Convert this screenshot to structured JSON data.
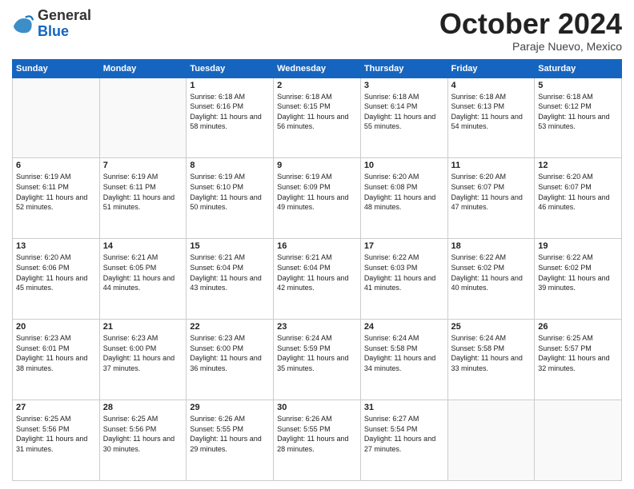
{
  "logo": {
    "general": "General",
    "blue": "Blue",
    "icon_color": "#1a7abf"
  },
  "header": {
    "month": "October 2024",
    "location": "Paraje Nuevo, Mexico"
  },
  "weekdays": [
    "Sunday",
    "Monday",
    "Tuesday",
    "Wednesday",
    "Thursday",
    "Friday",
    "Saturday"
  ],
  "weeks": [
    [
      {
        "day": "",
        "empty": true
      },
      {
        "day": "",
        "empty": true
      },
      {
        "day": "1",
        "sunrise": "Sunrise: 6:18 AM",
        "sunset": "Sunset: 6:16 PM",
        "daylight": "Daylight: 11 hours and 58 minutes."
      },
      {
        "day": "2",
        "sunrise": "Sunrise: 6:18 AM",
        "sunset": "Sunset: 6:15 PM",
        "daylight": "Daylight: 11 hours and 56 minutes."
      },
      {
        "day": "3",
        "sunrise": "Sunrise: 6:18 AM",
        "sunset": "Sunset: 6:14 PM",
        "daylight": "Daylight: 11 hours and 55 minutes."
      },
      {
        "day": "4",
        "sunrise": "Sunrise: 6:18 AM",
        "sunset": "Sunset: 6:13 PM",
        "daylight": "Daylight: 11 hours and 54 minutes."
      },
      {
        "day": "5",
        "sunrise": "Sunrise: 6:18 AM",
        "sunset": "Sunset: 6:12 PM",
        "daylight": "Daylight: 11 hours and 53 minutes."
      }
    ],
    [
      {
        "day": "6",
        "sunrise": "Sunrise: 6:19 AM",
        "sunset": "Sunset: 6:11 PM",
        "daylight": "Daylight: 11 hours and 52 minutes."
      },
      {
        "day": "7",
        "sunrise": "Sunrise: 6:19 AM",
        "sunset": "Sunset: 6:11 PM",
        "daylight": "Daylight: 11 hours and 51 minutes."
      },
      {
        "day": "8",
        "sunrise": "Sunrise: 6:19 AM",
        "sunset": "Sunset: 6:10 PM",
        "daylight": "Daylight: 11 hours and 50 minutes."
      },
      {
        "day": "9",
        "sunrise": "Sunrise: 6:19 AM",
        "sunset": "Sunset: 6:09 PM",
        "daylight": "Daylight: 11 hours and 49 minutes."
      },
      {
        "day": "10",
        "sunrise": "Sunrise: 6:20 AM",
        "sunset": "Sunset: 6:08 PM",
        "daylight": "Daylight: 11 hours and 48 minutes."
      },
      {
        "day": "11",
        "sunrise": "Sunrise: 6:20 AM",
        "sunset": "Sunset: 6:07 PM",
        "daylight": "Daylight: 11 hours and 47 minutes."
      },
      {
        "day": "12",
        "sunrise": "Sunrise: 6:20 AM",
        "sunset": "Sunset: 6:07 PM",
        "daylight": "Daylight: 11 hours and 46 minutes."
      }
    ],
    [
      {
        "day": "13",
        "sunrise": "Sunrise: 6:20 AM",
        "sunset": "Sunset: 6:06 PM",
        "daylight": "Daylight: 11 hours and 45 minutes."
      },
      {
        "day": "14",
        "sunrise": "Sunrise: 6:21 AM",
        "sunset": "Sunset: 6:05 PM",
        "daylight": "Daylight: 11 hours and 44 minutes."
      },
      {
        "day": "15",
        "sunrise": "Sunrise: 6:21 AM",
        "sunset": "Sunset: 6:04 PM",
        "daylight": "Daylight: 11 hours and 43 minutes."
      },
      {
        "day": "16",
        "sunrise": "Sunrise: 6:21 AM",
        "sunset": "Sunset: 6:04 PM",
        "daylight": "Daylight: 11 hours and 42 minutes."
      },
      {
        "day": "17",
        "sunrise": "Sunrise: 6:22 AM",
        "sunset": "Sunset: 6:03 PM",
        "daylight": "Daylight: 11 hours and 41 minutes."
      },
      {
        "day": "18",
        "sunrise": "Sunrise: 6:22 AM",
        "sunset": "Sunset: 6:02 PM",
        "daylight": "Daylight: 11 hours and 40 minutes."
      },
      {
        "day": "19",
        "sunrise": "Sunrise: 6:22 AM",
        "sunset": "Sunset: 6:02 PM",
        "daylight": "Daylight: 11 hours and 39 minutes."
      }
    ],
    [
      {
        "day": "20",
        "sunrise": "Sunrise: 6:23 AM",
        "sunset": "Sunset: 6:01 PM",
        "daylight": "Daylight: 11 hours and 38 minutes."
      },
      {
        "day": "21",
        "sunrise": "Sunrise: 6:23 AM",
        "sunset": "Sunset: 6:00 PM",
        "daylight": "Daylight: 11 hours and 37 minutes."
      },
      {
        "day": "22",
        "sunrise": "Sunrise: 6:23 AM",
        "sunset": "Sunset: 6:00 PM",
        "daylight": "Daylight: 11 hours and 36 minutes."
      },
      {
        "day": "23",
        "sunrise": "Sunrise: 6:24 AM",
        "sunset": "Sunset: 5:59 PM",
        "daylight": "Daylight: 11 hours and 35 minutes."
      },
      {
        "day": "24",
        "sunrise": "Sunrise: 6:24 AM",
        "sunset": "Sunset: 5:58 PM",
        "daylight": "Daylight: 11 hours and 34 minutes."
      },
      {
        "day": "25",
        "sunrise": "Sunrise: 6:24 AM",
        "sunset": "Sunset: 5:58 PM",
        "daylight": "Daylight: 11 hours and 33 minutes."
      },
      {
        "day": "26",
        "sunrise": "Sunrise: 6:25 AM",
        "sunset": "Sunset: 5:57 PM",
        "daylight": "Daylight: 11 hours and 32 minutes."
      }
    ],
    [
      {
        "day": "27",
        "sunrise": "Sunrise: 6:25 AM",
        "sunset": "Sunset: 5:56 PM",
        "daylight": "Daylight: 11 hours and 31 minutes."
      },
      {
        "day": "28",
        "sunrise": "Sunrise: 6:25 AM",
        "sunset": "Sunset: 5:56 PM",
        "daylight": "Daylight: 11 hours and 30 minutes."
      },
      {
        "day": "29",
        "sunrise": "Sunrise: 6:26 AM",
        "sunset": "Sunset: 5:55 PM",
        "daylight": "Daylight: 11 hours and 29 minutes."
      },
      {
        "day": "30",
        "sunrise": "Sunrise: 6:26 AM",
        "sunset": "Sunset: 5:55 PM",
        "daylight": "Daylight: 11 hours and 28 minutes."
      },
      {
        "day": "31",
        "sunrise": "Sunrise: 6:27 AM",
        "sunset": "Sunset: 5:54 PM",
        "daylight": "Daylight: 11 hours and 27 minutes."
      },
      {
        "day": "",
        "empty": true
      },
      {
        "day": "",
        "empty": true
      }
    ]
  ]
}
